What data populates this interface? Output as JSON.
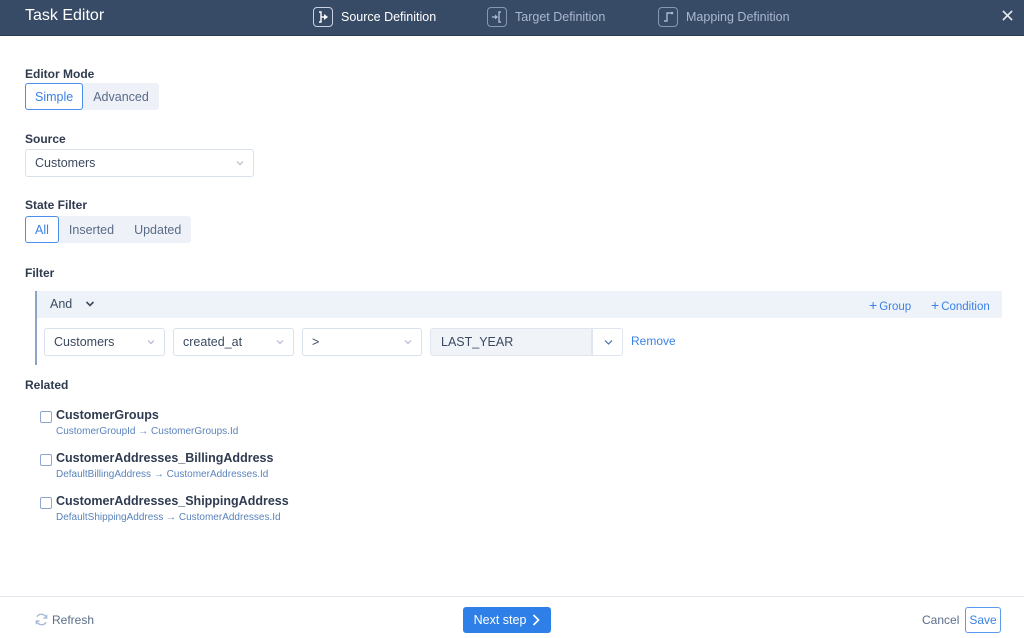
{
  "header": {
    "title": "Task Editor",
    "steps": [
      {
        "label": "Source Definition",
        "icon": "source-definition-icon",
        "active": true
      },
      {
        "label": "Target Definition",
        "icon": "target-definition-icon",
        "active": false
      },
      {
        "label": "Mapping Definition",
        "icon": "mapping-definition-icon",
        "active": false
      }
    ],
    "close_icon": "close-icon"
  },
  "editor_mode": {
    "label": "Editor Mode",
    "options": [
      "Simple",
      "Advanced"
    ],
    "selected": "Simple"
  },
  "source": {
    "label": "Source",
    "value": "Customers"
  },
  "state_filter": {
    "label": "State Filter",
    "options": [
      "All",
      "Inserted",
      "Updated"
    ],
    "selected": "All"
  },
  "filter": {
    "label": "Filter",
    "operator": "And",
    "add_group": "Group",
    "add_condition": "Condition",
    "condition": {
      "object": "Customers",
      "field": "created_at",
      "comparison": ">",
      "value": "LAST_YEAR",
      "remove_label": "Remove"
    }
  },
  "related": {
    "label": "Related",
    "items": [
      {
        "name": "CustomerGroups",
        "relation": "CustomerGroupId → CustomerGroups.Id",
        "checked": false
      },
      {
        "name": "CustomerAddresses_BillingAddress",
        "relation": "DefaultBillingAddress → CustomerAddresses.Id",
        "checked": false
      },
      {
        "name": "CustomerAddresses_ShippingAddress",
        "relation": "DefaultShippingAddress → CustomerAddresses.Id",
        "checked": false
      }
    ]
  },
  "footer": {
    "refresh_label": "Refresh",
    "next_label": "Next step",
    "cancel_label": "Cancel",
    "save_label": "Save"
  },
  "colors": {
    "header_bg": "#384b66",
    "accent": "#2f7fe8",
    "link": "#3a82e6"
  }
}
